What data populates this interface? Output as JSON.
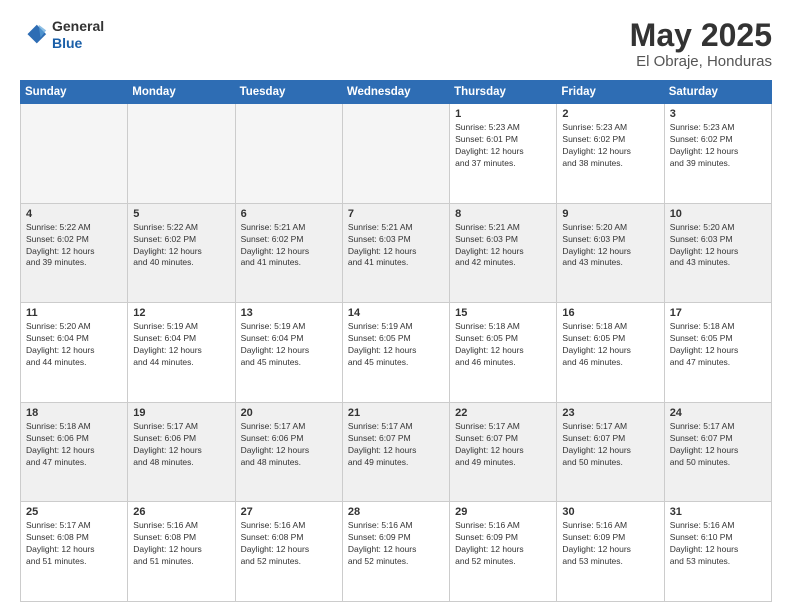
{
  "header": {
    "logo_line1": "General",
    "logo_line2": "Blue",
    "month_title": "May 2025",
    "location": "El Obraje, Honduras"
  },
  "days_of_week": [
    "Sunday",
    "Monday",
    "Tuesday",
    "Wednesday",
    "Thursday",
    "Friday",
    "Saturday"
  ],
  "weeks": [
    [
      {
        "num": "",
        "info": ""
      },
      {
        "num": "",
        "info": ""
      },
      {
        "num": "",
        "info": ""
      },
      {
        "num": "",
        "info": ""
      },
      {
        "num": "1",
        "info": "Sunrise: 5:23 AM\nSunset: 6:01 PM\nDaylight: 12 hours\nand 37 minutes."
      },
      {
        "num": "2",
        "info": "Sunrise: 5:23 AM\nSunset: 6:02 PM\nDaylight: 12 hours\nand 38 minutes."
      },
      {
        "num": "3",
        "info": "Sunrise: 5:23 AM\nSunset: 6:02 PM\nDaylight: 12 hours\nand 39 minutes."
      }
    ],
    [
      {
        "num": "4",
        "info": "Sunrise: 5:22 AM\nSunset: 6:02 PM\nDaylight: 12 hours\nand 39 minutes."
      },
      {
        "num": "5",
        "info": "Sunrise: 5:22 AM\nSunset: 6:02 PM\nDaylight: 12 hours\nand 40 minutes."
      },
      {
        "num": "6",
        "info": "Sunrise: 5:21 AM\nSunset: 6:02 PM\nDaylight: 12 hours\nand 41 minutes."
      },
      {
        "num": "7",
        "info": "Sunrise: 5:21 AM\nSunset: 6:03 PM\nDaylight: 12 hours\nand 41 minutes."
      },
      {
        "num": "8",
        "info": "Sunrise: 5:21 AM\nSunset: 6:03 PM\nDaylight: 12 hours\nand 42 minutes."
      },
      {
        "num": "9",
        "info": "Sunrise: 5:20 AM\nSunset: 6:03 PM\nDaylight: 12 hours\nand 43 minutes."
      },
      {
        "num": "10",
        "info": "Sunrise: 5:20 AM\nSunset: 6:03 PM\nDaylight: 12 hours\nand 43 minutes."
      }
    ],
    [
      {
        "num": "11",
        "info": "Sunrise: 5:20 AM\nSunset: 6:04 PM\nDaylight: 12 hours\nand 44 minutes."
      },
      {
        "num": "12",
        "info": "Sunrise: 5:19 AM\nSunset: 6:04 PM\nDaylight: 12 hours\nand 44 minutes."
      },
      {
        "num": "13",
        "info": "Sunrise: 5:19 AM\nSunset: 6:04 PM\nDaylight: 12 hours\nand 45 minutes."
      },
      {
        "num": "14",
        "info": "Sunrise: 5:19 AM\nSunset: 6:05 PM\nDaylight: 12 hours\nand 45 minutes."
      },
      {
        "num": "15",
        "info": "Sunrise: 5:18 AM\nSunset: 6:05 PM\nDaylight: 12 hours\nand 46 minutes."
      },
      {
        "num": "16",
        "info": "Sunrise: 5:18 AM\nSunset: 6:05 PM\nDaylight: 12 hours\nand 46 minutes."
      },
      {
        "num": "17",
        "info": "Sunrise: 5:18 AM\nSunset: 6:05 PM\nDaylight: 12 hours\nand 47 minutes."
      }
    ],
    [
      {
        "num": "18",
        "info": "Sunrise: 5:18 AM\nSunset: 6:06 PM\nDaylight: 12 hours\nand 47 minutes."
      },
      {
        "num": "19",
        "info": "Sunrise: 5:17 AM\nSunset: 6:06 PM\nDaylight: 12 hours\nand 48 minutes."
      },
      {
        "num": "20",
        "info": "Sunrise: 5:17 AM\nSunset: 6:06 PM\nDaylight: 12 hours\nand 48 minutes."
      },
      {
        "num": "21",
        "info": "Sunrise: 5:17 AM\nSunset: 6:07 PM\nDaylight: 12 hours\nand 49 minutes."
      },
      {
        "num": "22",
        "info": "Sunrise: 5:17 AM\nSunset: 6:07 PM\nDaylight: 12 hours\nand 49 minutes."
      },
      {
        "num": "23",
        "info": "Sunrise: 5:17 AM\nSunset: 6:07 PM\nDaylight: 12 hours\nand 50 minutes."
      },
      {
        "num": "24",
        "info": "Sunrise: 5:17 AM\nSunset: 6:07 PM\nDaylight: 12 hours\nand 50 minutes."
      }
    ],
    [
      {
        "num": "25",
        "info": "Sunrise: 5:17 AM\nSunset: 6:08 PM\nDaylight: 12 hours\nand 51 minutes."
      },
      {
        "num": "26",
        "info": "Sunrise: 5:16 AM\nSunset: 6:08 PM\nDaylight: 12 hours\nand 51 minutes."
      },
      {
        "num": "27",
        "info": "Sunrise: 5:16 AM\nSunset: 6:08 PM\nDaylight: 12 hours\nand 52 minutes."
      },
      {
        "num": "28",
        "info": "Sunrise: 5:16 AM\nSunset: 6:09 PM\nDaylight: 12 hours\nand 52 minutes."
      },
      {
        "num": "29",
        "info": "Sunrise: 5:16 AM\nSunset: 6:09 PM\nDaylight: 12 hours\nand 52 minutes."
      },
      {
        "num": "30",
        "info": "Sunrise: 5:16 AM\nSunset: 6:09 PM\nDaylight: 12 hours\nand 53 minutes."
      },
      {
        "num": "31",
        "info": "Sunrise: 5:16 AM\nSunset: 6:10 PM\nDaylight: 12 hours\nand 53 minutes."
      }
    ]
  ]
}
